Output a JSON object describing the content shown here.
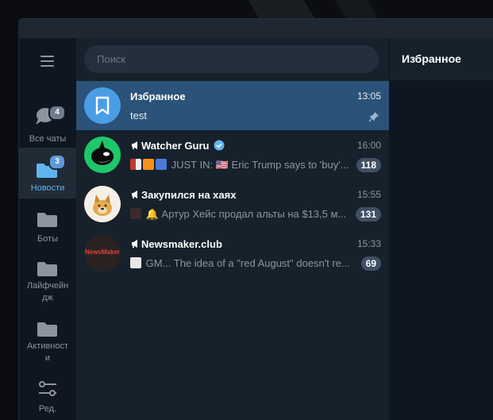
{
  "colors": {
    "accent": "#5fb4f0",
    "active_chat_bg": "#2b5278",
    "badge_muted": "#3f5064",
    "badge_bright": "#5a8fc8"
  },
  "sidebar": {
    "menu_icon": "hamburger-icon",
    "folders": [
      {
        "label": "Все чаты",
        "icon": "chats-icon",
        "badge": "4",
        "active": false
      },
      {
        "label": "Новости",
        "icon": "folder-icon",
        "badge": "3",
        "active": true
      },
      {
        "label": "Боты",
        "icon": "folder-icon",
        "active": false
      },
      {
        "label": "Лайфчейн\nдж",
        "icon": "folder-icon",
        "active": false
      },
      {
        "label": "Активност\nи",
        "icon": "folder-icon",
        "active": false
      },
      {
        "label": "Ред.",
        "icon": "sliders-icon",
        "active": false
      }
    ]
  },
  "search": {
    "placeholder": "Поиск"
  },
  "chats": [
    {
      "name": "Избранное",
      "time": "13:05",
      "preview": "test",
      "pinned": true,
      "active": true
    },
    {
      "name": "Watcher Guru",
      "time": "16:00",
      "preview": "JUST IN: 🇺🇸 Eric Trump says to 'buy'...",
      "unread": "118",
      "verified": true,
      "channel": true
    },
    {
      "name": "Закупился на хаях",
      "time": "15:55",
      "preview": "🔔 Артур Хейс продал альты на $13,5 м...",
      "unread": "131",
      "channel": true
    },
    {
      "name": "Newsmaker.club",
      "time": "15:33",
      "preview": "GM...  The idea of a \"red August\" doesn't re...",
      "unread": "69",
      "channel": true,
      "avatar_text": "NewsMaker"
    }
  ],
  "conversation": {
    "title": "Избранное"
  }
}
